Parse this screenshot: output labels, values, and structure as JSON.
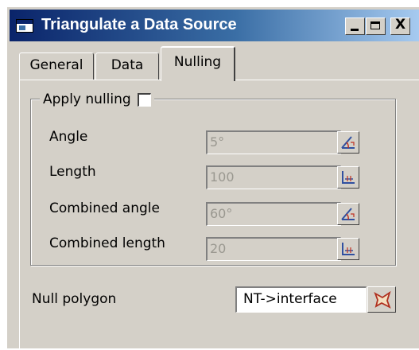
{
  "window": {
    "title": "Triangulate a Data Source",
    "close_glyph": "X",
    "icons": {
      "minimize": "minimize-icon",
      "maximize": "maximize-icon",
      "close": "close-icon"
    }
  },
  "tabs": [
    {
      "label": "General",
      "active": false
    },
    {
      "label": "Data",
      "active": false
    },
    {
      "label": "Nulling",
      "active": true
    }
  ],
  "nulling": {
    "apply_label": "Apply nulling",
    "apply_checked": false,
    "fields": [
      {
        "label": "Angle",
        "value": "5°",
        "pick_icon": "angle-pick-icon"
      },
      {
        "label": "Length",
        "value": "100",
        "pick_icon": "length-pick-icon"
      },
      {
        "label": "Combined angle",
        "value": "60°",
        "pick_icon": "angle-pick-icon"
      },
      {
        "label": "Combined length",
        "value": "20",
        "pick_icon": "length-pick-icon"
      }
    ],
    "null_polygon_label": "Null polygon",
    "null_polygon_value": "NT->interface",
    "null_polygon_icon": "polygon-pick-icon"
  },
  "colors": {
    "dialog_bg": "#d4d0c8",
    "title_gradient_start": "#0a246a",
    "title_gradient_end": "#a6caf0",
    "disabled_text": "#9a9890"
  }
}
